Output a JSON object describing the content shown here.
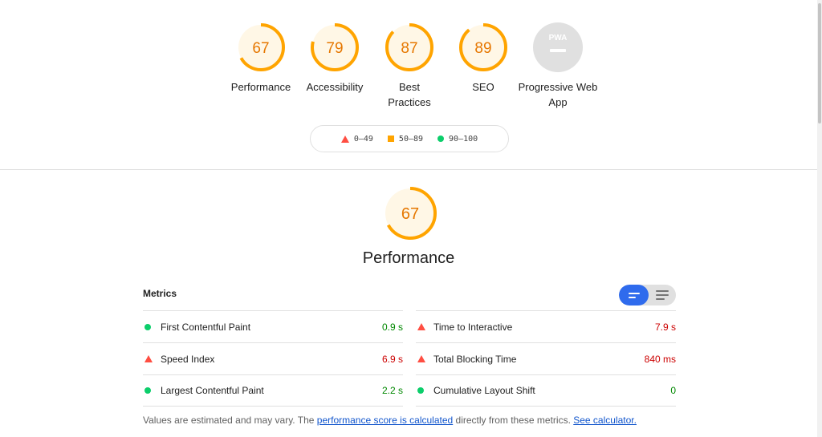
{
  "categories": [
    {
      "score": "67",
      "label": "Performance",
      "fraction": 0.67,
      "color": "#ffa400"
    },
    {
      "score": "79",
      "label": "Accessibility",
      "fraction": 0.79,
      "color": "#ffa400"
    },
    {
      "score": "87",
      "label": "Best Practices",
      "fraction": 0.87,
      "color": "#ffa400"
    },
    {
      "score": "89",
      "label": "SEO",
      "fraction": 0.89,
      "color": "#ffa400"
    },
    {
      "badge": "PWA",
      "label": "Progressive Web App"
    }
  ],
  "legend": {
    "fail": "0–49",
    "average": "50–89",
    "pass": "90–100"
  },
  "main": {
    "score": "67",
    "fraction": 0.67,
    "title": "Performance"
  },
  "metrics": {
    "header": "Metrics",
    "left": [
      {
        "status": "pass",
        "name": "First Contentful Paint",
        "value": "0.9 s"
      },
      {
        "status": "fail",
        "name": "Speed Index",
        "value": "6.9 s"
      },
      {
        "status": "pass",
        "name": "Largest Contentful Paint",
        "value": "2.2 s"
      }
    ],
    "right": [
      {
        "status": "fail",
        "name": "Time to Interactive",
        "value": "7.9 s"
      },
      {
        "status": "fail",
        "name": "Total Blocking Time",
        "value": "840 ms"
      },
      {
        "status": "pass",
        "name": "Cumulative Layout Shift",
        "value": "0"
      }
    ]
  },
  "footnote": {
    "text1": "Values are estimated and may vary. The ",
    "link1": "performance score is calculated",
    "text2": " directly from these metrics. ",
    "link2": "See calculator."
  },
  "colors": {
    "average": "#ffa400",
    "fail": "#ff4e42",
    "pass": "#0cce6b",
    "toggle_active": "#2f6bed"
  }
}
